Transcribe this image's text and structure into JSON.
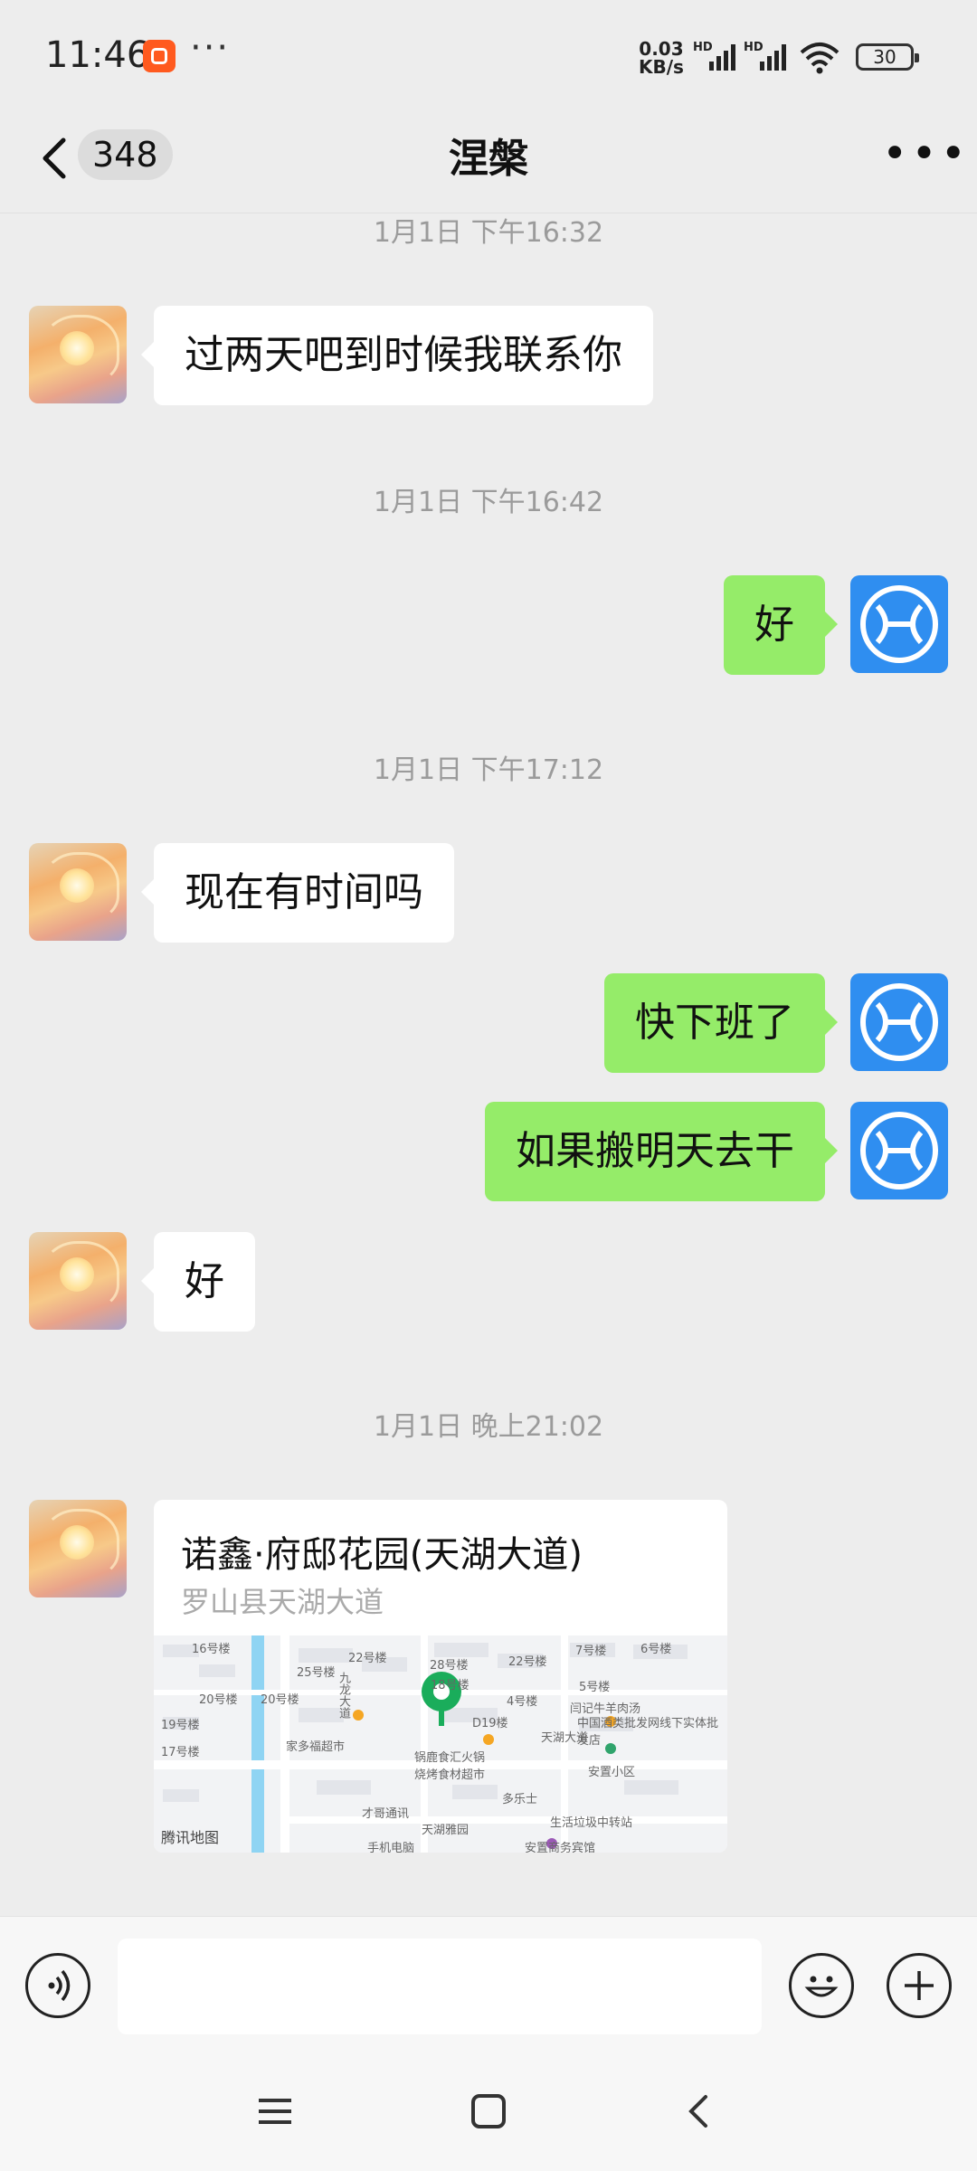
{
  "status_bar": {
    "time": "11:46",
    "net_speed_value": "0.03",
    "net_speed_unit": "KB/s",
    "signal_1_label": "HD",
    "signal_2_label": "HD",
    "battery": "30"
  },
  "header": {
    "unread_count": "348",
    "title": "涅槃"
  },
  "messages": [
    {
      "timestamp": "1月1日 下午16:32"
    },
    {
      "from": "peer",
      "text": "过两天吧到时候我联系你"
    },
    {
      "timestamp": "1月1日 下午16:42"
    },
    {
      "from": "me",
      "text": "好"
    },
    {
      "timestamp": "1月1日 下午17:12"
    },
    {
      "from": "peer",
      "text": "现在有时间吗"
    },
    {
      "from": "me",
      "text": "快下班了"
    },
    {
      "from": "me",
      "text": "如果搬明天去干"
    },
    {
      "from": "peer",
      "text": "好"
    },
    {
      "timestamp": "1月1日 晚上21:02"
    },
    {
      "from": "peer",
      "location": {
        "name": "诺鑫·府邸花园(天湖大道)",
        "address": "罗山县天湖大道",
        "map_brand": "腾讯地图",
        "map_labels": [
          "16号楼",
          "25号楼",
          "22号楼",
          "20号楼",
          "19号楼",
          "17号楼",
          "九龙大道",
          "28号楼",
          "22号楼",
          "7号楼",
          "6号楼",
          "5号楼",
          "4号楼",
          "18号楼",
          "20号楼",
          "D19楼",
          "闫记牛羊肉汤",
          "中国酒类批发网线下实体批发店",
          "家多福超市",
          "锅鹿食汇火锅烧烤食材超市",
          "天湖大道",
          "安置小区",
          "多乐士",
          "才哥通讯",
          "生活垃圾中转站",
          "天湖雅园",
          "手机电脑",
          "安置商务宾馆"
        ]
      }
    }
  ],
  "colors": {
    "background": "#ededed",
    "outgoing_bubble": "#95ec69",
    "incoming_bubble": "#ffffff",
    "map_pin": "#1aad5b"
  }
}
